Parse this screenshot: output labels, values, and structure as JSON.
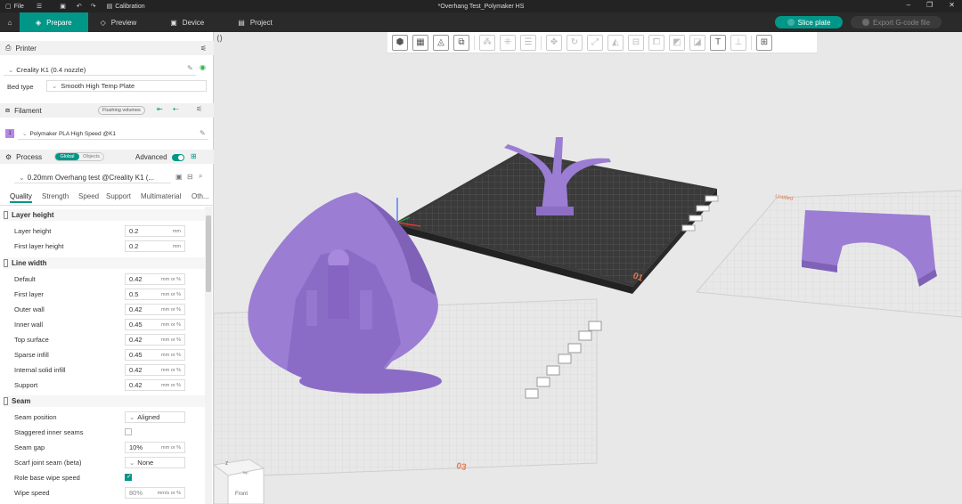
{
  "titlebar": {
    "file_label": "File",
    "calibration_label": "Calibration",
    "window_title": "*Overhang Test_Polymaker HS"
  },
  "tabs": [
    {
      "label": "Prepare"
    },
    {
      "label": "Preview"
    },
    {
      "label": "Device"
    },
    {
      "label": "Project"
    }
  ],
  "actions": {
    "slice_label": "Slice plate",
    "export_label": "Export G-code file"
  },
  "printer": {
    "section_label": "Printer",
    "selected": "Creality K1 (0.4 nozzle)",
    "bed_type_label": "Bed type",
    "bed_type": "Smooth High Temp Plate"
  },
  "filament": {
    "section_label": "Filament",
    "flushing_label": "Flushing volumes",
    "slot": "1",
    "selected": "Polymaker PLA High Speed @K1",
    "slot_color": "#b388e8"
  },
  "process": {
    "section_label": "Process",
    "toggle_global": "Global",
    "toggle_objects": "Objects",
    "advanced_label": "Advanced",
    "profile": "0.20mm Overhang test @Creality K1 (...",
    "tabs": [
      "Quality",
      "Strength",
      "Speed",
      "Support",
      "Multimaterial",
      "Oth..."
    ]
  },
  "settings": {
    "layer_height": {
      "title": "Layer height",
      "rows": [
        {
          "label": "Layer height",
          "value": "0.2",
          "unit": "mm"
        },
        {
          "label": "First layer height",
          "value": "0.2",
          "unit": "mm"
        }
      ]
    },
    "line_width": {
      "title": "Line width",
      "rows": [
        {
          "label": "Default",
          "value": "0.42",
          "unit": "mm or %"
        },
        {
          "label": "First layer",
          "value": "0.5",
          "unit": "mm or %"
        },
        {
          "label": "Outer wall",
          "value": "0.42",
          "unit": "mm or %"
        },
        {
          "label": "Inner wall",
          "value": "0.45",
          "unit": "mm or %"
        },
        {
          "label": "Top surface",
          "value": "0.42",
          "unit": "mm or %"
        },
        {
          "label": "Sparse infill",
          "value": "0.45",
          "unit": "mm or %"
        },
        {
          "label": "Internal solid infill",
          "value": "0.42",
          "unit": "mm or %"
        },
        {
          "label": "Support",
          "value": "0.42",
          "unit": "mm or %"
        }
      ]
    },
    "seam": {
      "title": "Seam",
      "seam_position_label": "Seam position",
      "seam_position": "Aligned",
      "staggered_label": "Staggered inner seams",
      "seam_gap_label": "Seam gap",
      "seam_gap": "10%",
      "seam_gap_unit": "mm or %",
      "scarf_label": "Scarf joint seam (beta)",
      "scarf": "None",
      "role_wipe_label": "Role base wipe speed",
      "wipe_speed_label": "Wipe speed",
      "wipe_speed": "80%",
      "wipe_speed_unit": "mm/s or %"
    }
  },
  "viewport": {
    "plate_labels": [
      "01",
      "03"
    ],
    "untitled_label": "Untitled",
    "cube_front": "Front",
    "cube_top": "Top",
    "axis_z": "Z"
  },
  "colors": {
    "accent": "#009688",
    "model": "#9b7dd4",
    "plate": "#2f2f2f"
  }
}
